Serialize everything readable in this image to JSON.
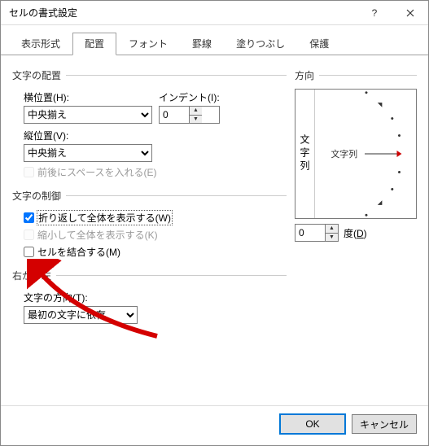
{
  "window": {
    "title": "セルの書式設定"
  },
  "tabs": [
    "表示形式",
    "配置",
    "フォント",
    "罫線",
    "塗りつぶし",
    "保護"
  ],
  "active_tab_index": 1,
  "alignment": {
    "legend": "文字の配置",
    "horizontal_label": "横位置(H):",
    "horizontal_value": "中央揃え",
    "vertical_label": "縦位置(V):",
    "vertical_value": "中央揃え",
    "indent_label": "インデント(I):",
    "indent_value": "0",
    "spacing_label": "前後にスペースを入れる(E)"
  },
  "control": {
    "legend": "文字の制御",
    "wrap_label": "折り返して全体を表示する(W)",
    "wrap_checked": true,
    "shrink_label": "縮小して全体を表示する(K)",
    "merge_label": "セルを結合する(M)"
  },
  "rtl": {
    "legend": "右から左",
    "dir_label": "文字の方向(T):",
    "dir_value": "最初の文字に依存"
  },
  "orientation": {
    "legend": "方向",
    "vertical_text": "文字列",
    "sample_text": "文字列",
    "degrees_value": "0",
    "degrees_label": "度(D)"
  },
  "buttons": {
    "ok": "OK",
    "cancel": "キャンセル"
  }
}
